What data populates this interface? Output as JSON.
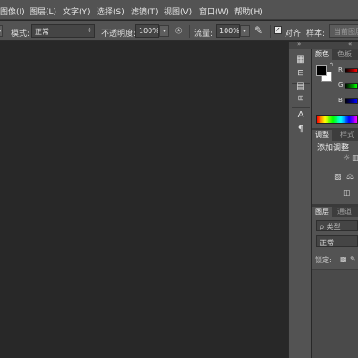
{
  "menubar": {
    "items": [
      "图像(I)",
      "图层(L)",
      "文字(Y)",
      "选择(S)",
      "滤镜(T)",
      "视图(V)",
      "窗口(W)",
      "帮助(H)"
    ]
  },
  "options": {
    "mode_label": "模式:",
    "mode_value": "正常",
    "opacity_label": "不透明度:",
    "opacity_value": "100%",
    "flow_label": "流量:",
    "flow_value": "100%",
    "align_label": "对齐",
    "sample_label": "样本:",
    "sample_value": "当前图层"
  },
  "color_panel": {
    "tabs": [
      "颜色",
      "色板"
    ],
    "channels": [
      "R",
      "G",
      "B"
    ],
    "foreground_color": "#000000",
    "background_color": "#ffffff"
  },
  "adjust_panel": {
    "tabs": [
      "调整",
      "样式"
    ],
    "title": "添加调整"
  },
  "layers_panel": {
    "tabs": [
      "图层",
      "通道"
    ],
    "filter_label": "ρ 类型",
    "blend_mode": "正常",
    "lock_label": "锁定:"
  }
}
